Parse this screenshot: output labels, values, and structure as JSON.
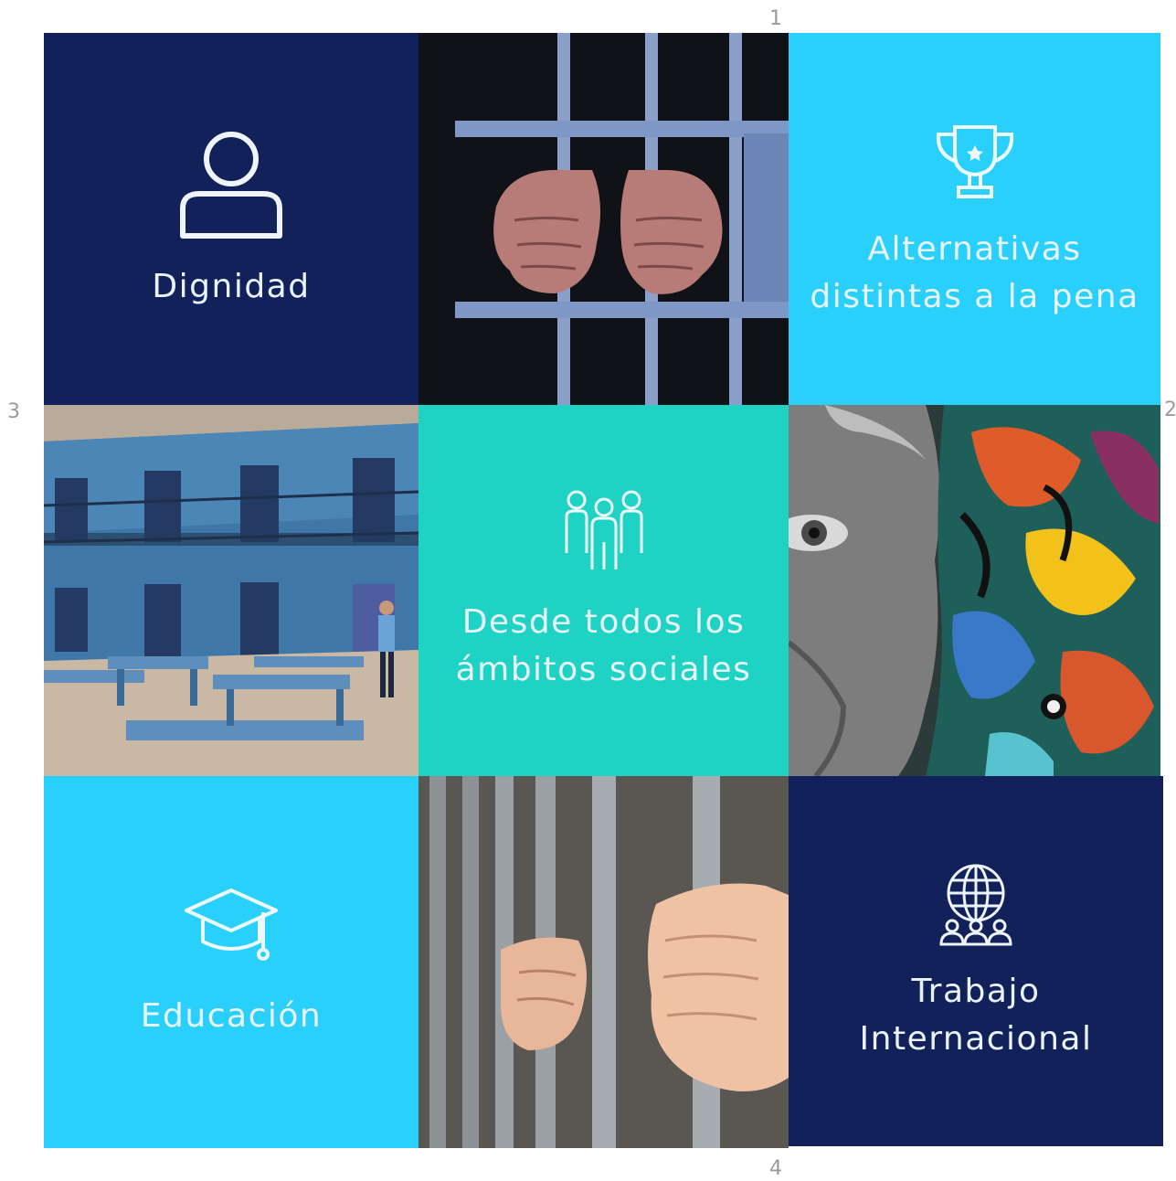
{
  "markers": [
    "1",
    "2",
    "3",
    "4"
  ],
  "tiles": {
    "dignidad": {
      "label": "Dignidad",
      "icon": "person-icon",
      "color": "#12215a"
    },
    "alternativas": {
      "label": "Alternativas\ndistintas a la pena",
      "icon": "trophy-icon",
      "color": "#28d0fb"
    },
    "social": {
      "label": "Desde todos los\námbitos sociales",
      "icon": "group-icon",
      "color": "#1ed3c4"
    },
    "educacion": {
      "label": "Educación",
      "icon": "graduation-cap-icon",
      "color": "#28d0fb"
    },
    "trabajo": {
      "label": "Trabajo\nInternacional",
      "icon": "globe-people-icon",
      "color": "#12215a"
    }
  },
  "photos": {
    "top_center": "hands-behind-bars-photo",
    "middle_left": "prison-courtyard-illustration",
    "middle_right": "graffiti-face-mural",
    "bottom_center": "hands-gripping-bars-photo"
  }
}
